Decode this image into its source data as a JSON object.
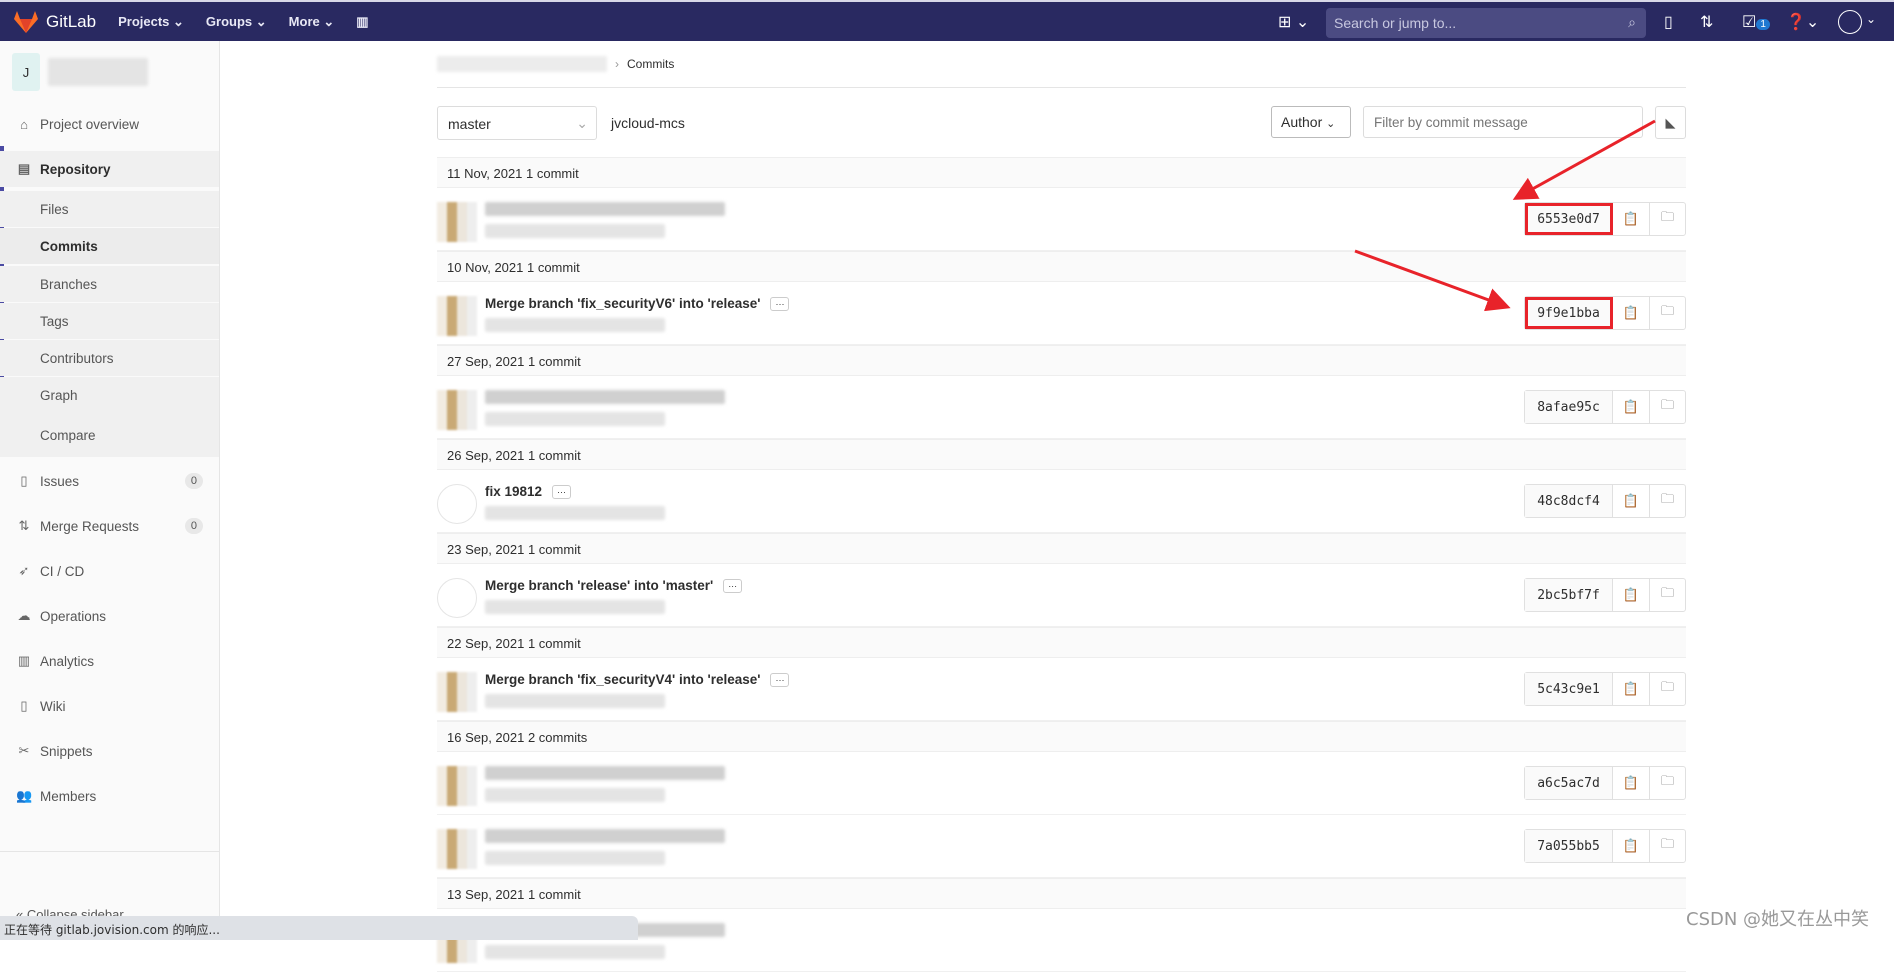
{
  "navbar": {
    "brand": "GitLab",
    "links": [
      "Projects",
      "Groups",
      "More"
    ],
    "search_placeholder": "Search or jump to...",
    "todo_count": "1"
  },
  "sidebar": {
    "project_initial": "J",
    "items": [
      {
        "label": "Project overview",
        "icon": "home-icon"
      },
      {
        "label": "Repository",
        "icon": "document-icon"
      },
      {
        "label": "Files"
      },
      {
        "label": "Commits"
      },
      {
        "label": "Branches"
      },
      {
        "label": "Tags"
      },
      {
        "label": "Contributors"
      },
      {
        "label": "Graph"
      },
      {
        "label": "Compare"
      },
      {
        "label": "Issues",
        "icon": "issues-icon",
        "badge": "0"
      },
      {
        "label": "Merge Requests",
        "icon": "merge-request-icon",
        "badge": "0"
      },
      {
        "label": "CI / CD",
        "icon": "rocket-icon"
      },
      {
        "label": "Operations",
        "icon": "cloud-gear-icon"
      },
      {
        "label": "Analytics",
        "icon": "chart-icon"
      },
      {
        "label": "Wiki",
        "icon": "book-icon"
      },
      {
        "label": "Snippets",
        "icon": "scissors-icon"
      },
      {
        "label": "Members",
        "icon": "users-icon"
      }
    ],
    "collapse": "Collapse sidebar"
  },
  "breadcrumb": {
    "current": "Commits"
  },
  "controls": {
    "branch": "master",
    "project": "jvcloud-mcs",
    "author": "Author",
    "filter_placeholder": "Filter by commit message"
  },
  "groups": [
    {
      "date": "11 Nov, 2021 1 commit",
      "commits": [
        {
          "message": "",
          "sha": "6553e0d7",
          "highlight": true,
          "avatar": "pixel"
        }
      ]
    },
    {
      "date": "10 Nov, 2021 1 commit",
      "commits": [
        {
          "message": "Merge branch 'fix_securityV6' into 'release'",
          "sha": "9f9e1bba",
          "highlight": true,
          "avatar": "pixel"
        }
      ]
    },
    {
      "date": "27 Sep, 2021 1 commit",
      "commits": [
        {
          "message": "",
          "sha": "8afae95c",
          "avatar": "pixel"
        }
      ]
    },
    {
      "date": "26 Sep, 2021 1 commit",
      "commits": [
        {
          "message": "fix 19812",
          "sha": "48c8dcf4",
          "avatar": "empty"
        }
      ]
    },
    {
      "date": "23 Sep, 2021 1 commit",
      "commits": [
        {
          "message": "Merge branch 'release' into 'master'",
          "sha": "2bc5bf7f",
          "avatar": "empty"
        }
      ]
    },
    {
      "date": "22 Sep, 2021 1 commit",
      "commits": [
        {
          "message": "Merge branch 'fix_securityV4' into 'release'",
          "sha": "5c43c9e1",
          "avatar": "pixel"
        }
      ]
    },
    {
      "date": "16 Sep, 2021 2 commits",
      "commits": [
        {
          "message": "",
          "sha": "a6c5ac7d",
          "avatar": "pixel"
        },
        {
          "message": "",
          "sha": "7a055bb5",
          "avatar": "pixel"
        }
      ]
    },
    {
      "date": "13 Sep, 2021 1 commit",
      "commits": [
        {
          "message": "",
          "sha": "",
          "avatar": "pixel"
        }
      ]
    }
  ],
  "status_bar": "正在等待 gitlab.jovision.com 的响应...",
  "watermark": "CSDN @她又在丛中笑",
  "colors": {
    "navbar": "#292961",
    "annotation": "#e8232a",
    "active_bar": "#4b4ba3"
  }
}
